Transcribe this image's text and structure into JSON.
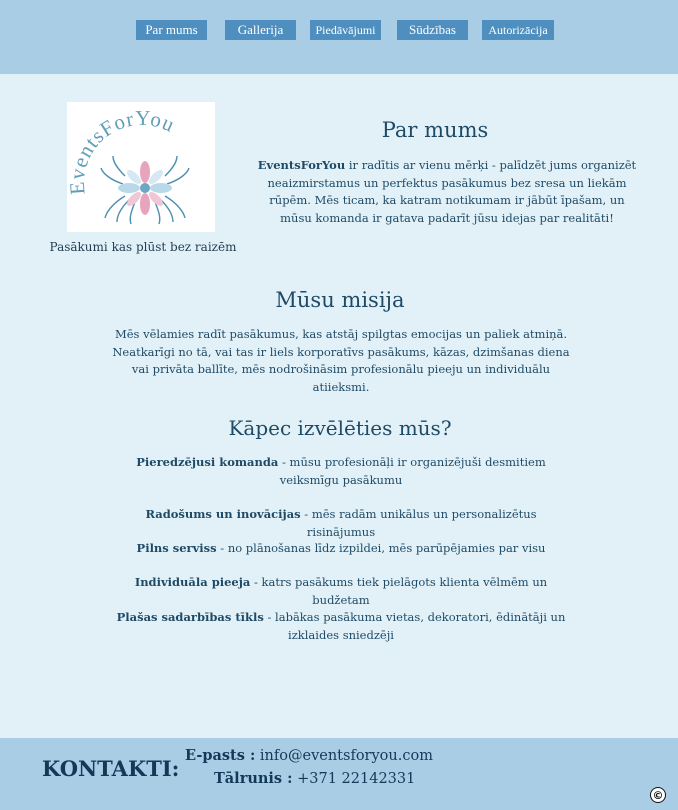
{
  "nav": {
    "items": [
      {
        "label": "Par mums"
      },
      {
        "label": "Gallerija"
      },
      {
        "label": "Piedāvājumi"
      },
      {
        "label": "Sūdzības"
      },
      {
        "label": "Autorizācija"
      }
    ]
  },
  "logo": {
    "text": "EventsForYou"
  },
  "tagline": "Pasākumi kas plūst bez raizēm",
  "about": {
    "title": "Par mums",
    "brand": "EventsForYou",
    "text": " ir radītis ar vienu mērķi - palīdzēt jums organizēt neaizmirstamus un perfektus pasākumus bez sresa un liekām rūpēm. Mēs ticam, ka katram notikumam ir jābūt īpašam, un mūsu komanda ir gatava padarīt jūsu idejas par realitāti!"
  },
  "mission": {
    "title": "Mūsu misija",
    "text": "Mēs vēlamies radīt pasākumus, kas atstāj spilgtas emocijas un paliek atmiņā. Neatkarīgi no tā, vai tas ir liels korporatīvs pasākums, kāzas, dzimšanas diena vai privāta ballīte, mēs nodrošināsim profesionālu pieeju un individuālu atiieksmi."
  },
  "why": {
    "title": "Kāpec izvēlēties mūs?",
    "items": [
      {
        "bold": "Pieredzējusi komanda",
        "text": " - mūsu profesionāļi ir organizējuši desmitiem veiksmīgu pasākumu"
      },
      {
        "bold": "Radošums un inovācijas",
        "text": " - mēs radām unikālus un personalizētus risinājumus"
      },
      {
        "bold": "Pilns serviss",
        "text": " - no plānošanas līdz izpildei, mēs parūpējamies par visu"
      },
      {
        "bold": "Individuāla pieeja",
        "text": " - katrs pasākums tiek pielāgots klienta vēlmēm un budžetam"
      },
      {
        "bold": "Plašas sadarbības tīkls",
        "text": " - labākas pasākuma vietas, dekoratori, ēdinātāji un izklaides sniedzēji"
      }
    ]
  },
  "footer": {
    "heading": "KONTAKTI:",
    "email_label": "E-pasts :",
    "email": " info@eventsforyou.com",
    "phone_label": "Tālrunis :",
    "phone": " +371 22142331",
    "copyright": "©"
  },
  "colors": {
    "header_bg": "#aacde6",
    "page_bg": "#e2f1f8",
    "nav_button": "#4f8fc0",
    "text": "#1f4a66"
  }
}
